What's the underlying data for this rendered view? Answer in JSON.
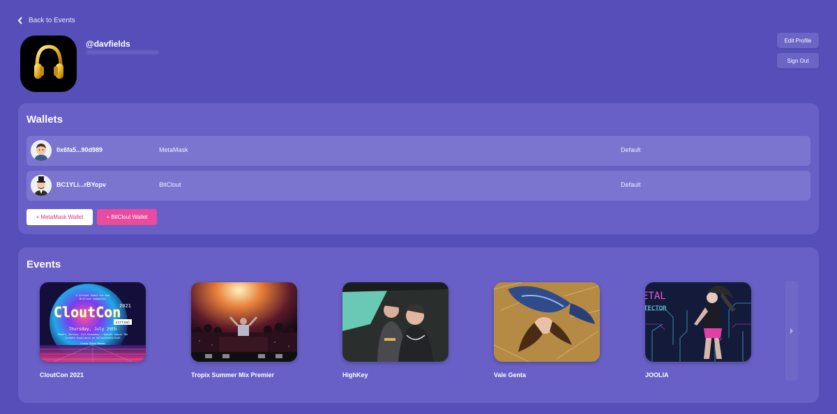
{
  "nav": {
    "back_label": "Back to Events"
  },
  "profile": {
    "username": "@davfields",
    "edit_label": "Edit Profile",
    "signout_label": "Sign Out",
    "avatar_icon": "headphones-icon"
  },
  "wallets": {
    "title": "Wallets",
    "rows": [
      {
        "address": "0x6fa5...90d989",
        "type": "MetaMask",
        "status": "Default",
        "avatar_icon": "person-avatar-icon"
      },
      {
        "address": "BC1YLi...rBYopv",
        "type": "BitClout",
        "status": "Default",
        "avatar_icon": "top-hat-avatar-icon"
      }
    ],
    "add_metamask_label": "+ MetaMask Wallet",
    "add_bitclout_label": "+ BitClout Wallet"
  },
  "events": {
    "title": "Events",
    "items": [
      {
        "name": "CloutCon 2021"
      },
      {
        "name": "Tropix Summer Mix Premier"
      },
      {
        "name": "HighKey"
      },
      {
        "name": "Vale Genta"
      },
      {
        "name": "JOOLIA"
      }
    ],
    "poster": {
      "line1": "A Virtual Event for the",
      "line2": "BitClout Community",
      "title": "CloutCon",
      "year": "2021",
      "tag": "virtual",
      "date": "Thursday, July 29th",
      "topics": "Panels, Parties, Cult Discovery + Special Guests TBA",
      "tickets": "Tickets Available at @CloutConVirtual",
      "lineup": "Lineup Shown Monday"
    },
    "joolia_poster": {
      "text1": "ETAL",
      "text2": "TECTOR"
    }
  },
  "colors": {
    "background": "#564fba",
    "panel": "#6860c6",
    "row": "#7b75cf",
    "accent_pink": "#e94b9f"
  }
}
